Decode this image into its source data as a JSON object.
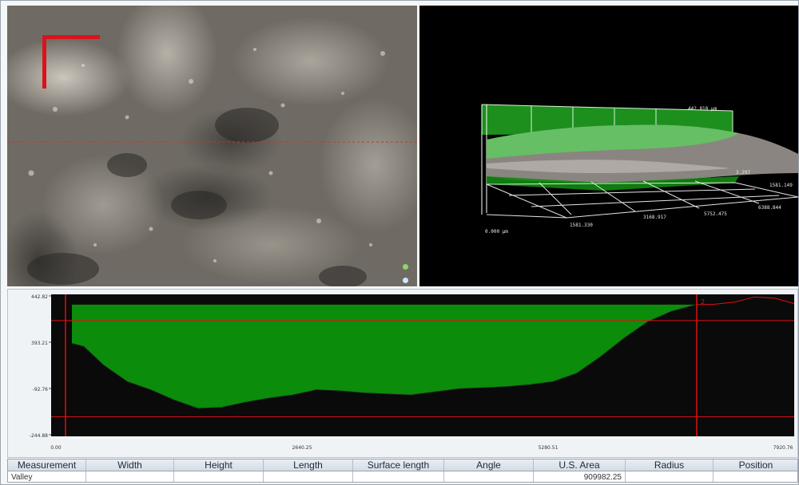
{
  "view3d": {
    "z_max_label": "442.810 μm",
    "z_mid_label": "3.297",
    "z_min_label": "0.000 μm",
    "x_tick_1": "1581.330",
    "x_tick_2": "3168.917",
    "x_tick_3": "5752.475",
    "x_tick_4": "6388.844",
    "x_tick_5": "1581.149"
  },
  "profile": {
    "y_ticks": [
      "442.82",
      "393.21",
      "-92.76",
      "-244.88"
    ],
    "x_ticks": [
      "0.00",
      "2640.25",
      "5280.51",
      "7920.76"
    ],
    "cursor_label": "2",
    "colors": {
      "fill": "#0b8c0b",
      "cursor": "#e01010",
      "background": "#0a0a0a"
    }
  },
  "chart_data": {
    "type": "area",
    "xlabel": "",
    "ylabel": "",
    "xlim": [
      0,
      7920.76
    ],
    "ylim": [
      -244.88,
      442.82
    ],
    "reference_level": 393.21,
    "x": [
      0,
      150,
      400,
      700,
      1000,
      1300,
      1600,
      1900,
      2200,
      2500,
      2800,
      3100,
      3400,
      3700,
      4000,
      4300,
      4600,
      4900,
      5200,
      5500,
      5800,
      6100,
      6400,
      6700,
      7000,
      7300,
      7600,
      7920.76
    ],
    "series": [
      {
        "values": [
          205,
          190,
          100,
          20,
          -20,
          -70,
          -110,
          -105,
          -80,
          -60,
          -45,
          -20,
          -25,
          -35,
          -40,
          -45,
          -30,
          -15,
          -10,
          -5,
          5,
          20,
          60,
          140,
          230,
          310,
          360,
          393
        ]
      }
    ],
    "right_trace": {
      "x": [
        7920.76,
        8100,
        8300,
        8500,
        8700,
        8900
      ],
      "values": [
        393,
        395,
        405,
        430,
        425,
        398
      ]
    }
  },
  "table": {
    "headers": [
      "Measurement",
      "Width",
      "Height",
      "Length",
      "Surface length",
      "Angle",
      "U.S. Area",
      "Radius",
      "Position"
    ],
    "rows": [
      [
        "Valley",
        "",
        "",
        "",
        "",
        "",
        "909982.25",
        "",
        ""
      ]
    ]
  }
}
